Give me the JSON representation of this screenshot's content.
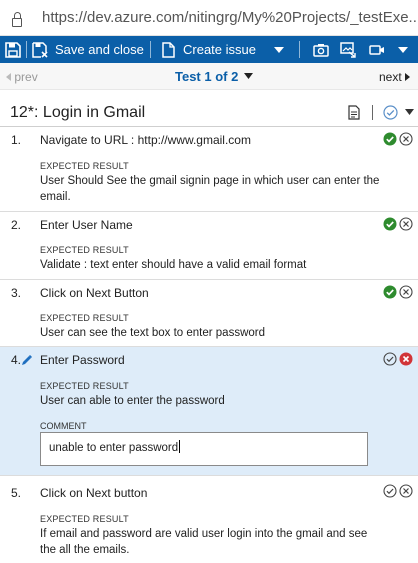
{
  "browser": {
    "url": "https://dev.azure.com/nitingrg/My%20Projects/_testExe..."
  },
  "toolbar": {
    "save_close_label": "Save and close",
    "create_issue_label": "Create issue"
  },
  "nav": {
    "prev_label": "prev",
    "test_label": "Test 1 of 2",
    "next_label": "next"
  },
  "test_case": {
    "title": "12*: Login in Gmail"
  },
  "expected_label": "EXPECTED RESULT",
  "comment_label": "COMMENT",
  "steps": [
    {
      "number": "1.",
      "action": "Navigate to URL : http://www.gmail.com",
      "expected": "User Should See the gmail signin page in which user can enter the email.",
      "status": "passed"
    },
    {
      "number": "2.",
      "action": "Enter User Name",
      "expected": "Validate :  text enter should have a valid email format",
      "status": "passed"
    },
    {
      "number": "3.",
      "action": "Click on Next Button",
      "expected": "User can see the text box to enter password",
      "status": "passed"
    },
    {
      "number": "4.",
      "action": "Enter Password",
      "expected": "User can able to enter the password",
      "status": "failed",
      "comment": "unable to enter password"
    },
    {
      "number": "5.",
      "action": "Click on Next button",
      "expected": "If email and password are valid user login into the gmail and see the all the emails.",
      "status": "not-run"
    }
  ],
  "colors": {
    "toolbar_bg": "#0b5fa8",
    "pass_green": "#2e8b2e",
    "fail_red": "#d13438",
    "selected_row_bg": "#deecf9",
    "link_blue": "#0b5fa8"
  }
}
